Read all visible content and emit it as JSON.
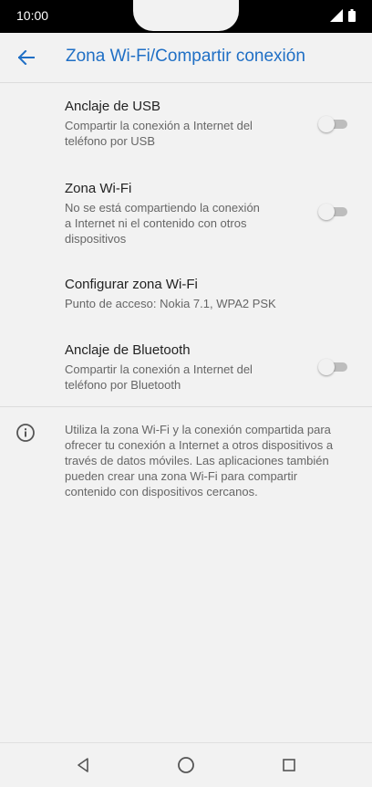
{
  "status_bar": {
    "time": "10:00"
  },
  "app_bar": {
    "title": "Zona Wi-Fi/Compartir conexión"
  },
  "settings": [
    {
      "label": "Anclaje de USB",
      "summary_lines": [
        "Compartir la conexión a Internet del",
        "teléfono por USB"
      ],
      "toggle": false
    },
    {
      "label": "Zona Wi-Fi",
      "summary_lines": [
        "No se está compartiendo la conexión",
        "a Internet ni el contenido con otros",
        "dispositivos"
      ],
      "toggle": false
    },
    {
      "label": "Configurar zona Wi-Fi",
      "summary_lines": [
        "Punto de acceso: Nokia 7.1, WPA2 PSK"
      ]
    },
    {
      "label": "Anclaje de Bluetooth",
      "summary_lines": [
        "Compartir la conexión a Internet del",
        "teléfono por Bluetooth"
      ],
      "toggle": false
    }
  ],
  "info": {
    "lines": [
      "Utiliza la zona Wi-Fi y la conexión compartida para",
      "ofrecer tu conexión a Internet a otros dispositivos a",
      "través de datos móviles. Las aplicaciones también",
      "pueden crear una zona Wi-Fi para compartir",
      "contenido con dispositivos cercanos."
    ]
  },
  "colors": {
    "accent": "#1f6fc5",
    "background": "#f2f2f2"
  },
  "icons": {
    "back": "arrow-left-icon",
    "info": "info-icon",
    "nav_back": "triangle-back-icon",
    "nav_home": "circle-home-icon",
    "nav_recents": "square-recents-icon",
    "signal": "signal-icon",
    "battery": "battery-icon"
  }
}
